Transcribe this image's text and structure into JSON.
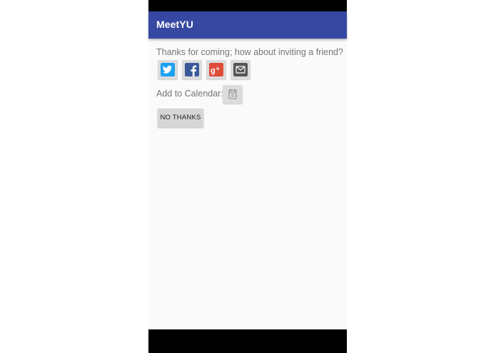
{
  "app": {
    "title": "MeetYU",
    "accent_color": "#3748a3"
  },
  "invite": {
    "text": "Thanks for coming; how about inviting a friend?",
    "share_buttons": [
      {
        "name": "twitter",
        "icon": "twitter-icon",
        "color": "#1da1f2"
      },
      {
        "name": "facebook",
        "icon": "facebook-icon",
        "color": "#3b5998"
      },
      {
        "name": "google-plus",
        "icon": "google-plus-icon",
        "color": "#dd4b39"
      },
      {
        "name": "email",
        "icon": "email-icon",
        "color": "#555555"
      }
    ]
  },
  "calendar": {
    "label": "Add to Calendar:",
    "icon": "calendar-icon"
  },
  "actions": {
    "no_thanks_label": "NO THANKS"
  }
}
